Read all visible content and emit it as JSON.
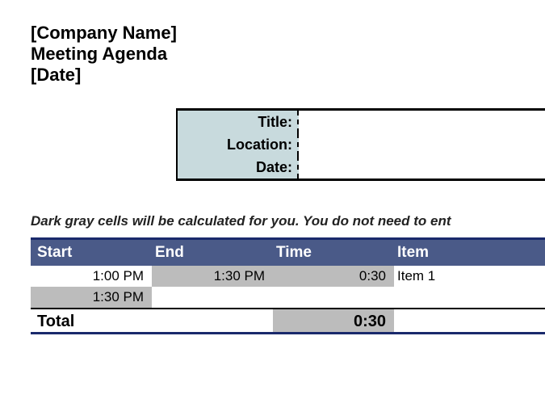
{
  "header": {
    "company_name": "[Company Name]",
    "doc_title": "Meeting Agenda",
    "date_placeholder": "[Date]"
  },
  "info": {
    "title_label": "Title:",
    "title_value": "",
    "location_label": "Location:",
    "location_value": "",
    "date_label": "Date:",
    "date_value": ""
  },
  "hint": "Dark gray cells will be calculated for you. You do not need to ent",
  "table": {
    "headers": {
      "start": "Start",
      "end": "End",
      "time": "Time",
      "item": "Item"
    },
    "rows": [
      {
        "start": "1:00 PM",
        "end": "1:30 PM",
        "time": "0:30",
        "item": "Item 1"
      },
      {
        "start": "1:30 PM",
        "end": "",
        "time": "",
        "item": ""
      }
    ],
    "total_label": "Total",
    "total_time": "0:30"
  }
}
